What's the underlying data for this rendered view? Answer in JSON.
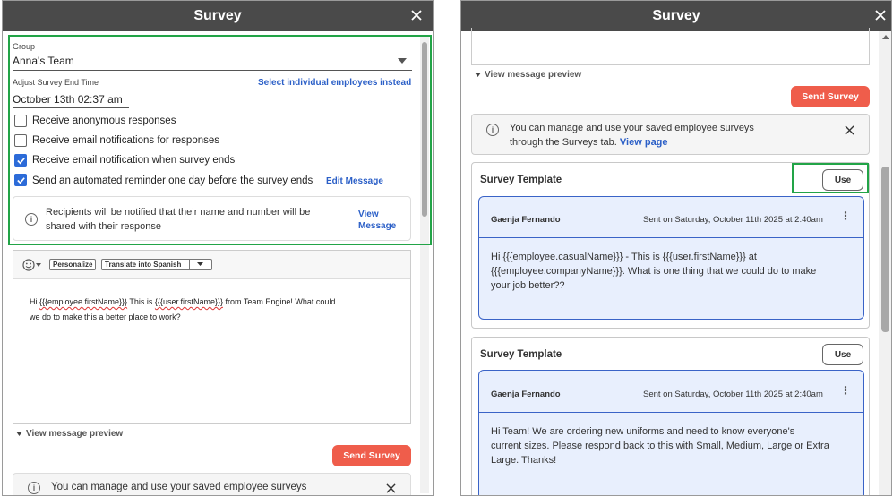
{
  "left": {
    "title": "Survey",
    "group_label": "Group",
    "group_value": "Anna's Team",
    "end_time_label": "Adjust Survey End Time",
    "end_time_value": "October 13th 02:37 am",
    "select_individuals_link": "Select individual employees instead",
    "checkboxes": [
      {
        "label": "Receive anonymous responses",
        "checked": false
      },
      {
        "label": "Receive email notifications for responses",
        "checked": false
      },
      {
        "label": "Receive email notification when survey ends",
        "checked": true
      },
      {
        "label": "Send an automated reminder one day before the survey ends",
        "checked": true
      }
    ],
    "edit_message_link": "Edit Message",
    "notice_line1": "Recipients will be notified that their name and number will be",
    "notice_line2": "shared with their response",
    "view_message_line1": "View",
    "view_message_line2": "Message",
    "toolbar": {
      "personalize": "Personalize",
      "translate": "Translate into Spanish"
    },
    "message": {
      "p1": "Hi ",
      "v1": "{{{employee.firstName}}}",
      "p2": "  This is  ",
      "v2": "{{{user.firstName}}}",
      "p3": " from Team Engine! What could",
      "line2": "we do to make this a better place to work?"
    },
    "view_preview": "View message preview",
    "send_survey": "Send Survey",
    "manage_notice": "You can manage and use your saved employee surveys"
  },
  "right": {
    "title": "Survey",
    "view_preview": "View message preview",
    "send_survey": "Send Survey",
    "manage_line1": "You can manage and use your saved employee surveys",
    "manage_line2": "through the Surveys tab.",
    "view_page": "View page",
    "templates": [
      {
        "title": "Survey Template",
        "use": "Use",
        "sender": "Gaenja Fernando",
        "sent": "Sent on Saturday, October 11th 2025 at 2:40am",
        "lines": [
          "Hi {{{employee.casualName}}} - This is {{{user.firstName}}} at",
          "{{{employee.companyName}}}. What is one thing that we could do to make",
          "your job better??"
        ]
      },
      {
        "title": "Survey Template",
        "use": "Use",
        "sender": "Gaenja Fernando",
        "sent": "Sent on Saturday, October 11th 2025 at 2:40am",
        "lines": [
          "Hi Team! We are ordering new uniforms and need to know everyone's",
          "current sizes. Please respond back to this with Small, Medium, Large or Extra",
          "Large. Thanks!"
        ]
      }
    ]
  }
}
